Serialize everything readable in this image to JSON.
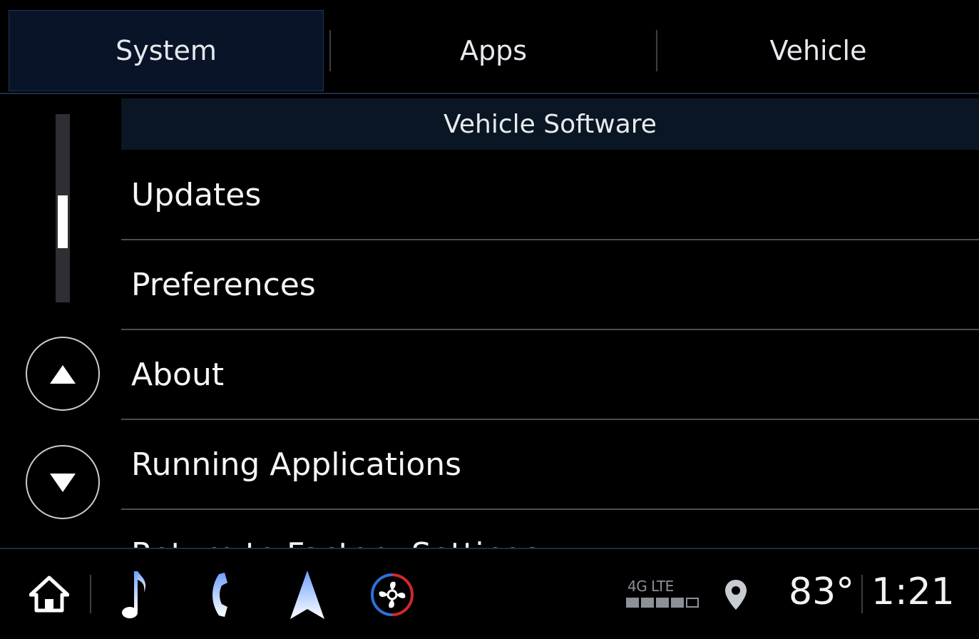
{
  "tabs": [
    {
      "label": "System",
      "active": true
    },
    {
      "label": "Apps",
      "active": false
    },
    {
      "label": "Vehicle",
      "active": false
    }
  ],
  "section": {
    "title": "Vehicle Software"
  },
  "list": {
    "items": [
      {
        "label": "Updates"
      },
      {
        "label": "Preferences"
      },
      {
        "label": "About"
      },
      {
        "label": "Running Applications"
      },
      {
        "label": "Return to Factory Settings"
      }
    ]
  },
  "scroll": {
    "position_fraction": 0.6,
    "thumb_fraction": 0.28
  },
  "status": {
    "network": "4G LTE",
    "signal_bars": 4,
    "signal_max": 5,
    "temperature": "83°",
    "time": "1:21"
  },
  "bottom_icons": [
    "home-icon",
    "music-note-icon",
    "phone-icon",
    "navigation-arrow-icon",
    "climate-fan-icon",
    "location-pin-icon"
  ],
  "colors": {
    "active_tab_bg": "#0a1428",
    "climate_red": "#d0282c",
    "climate_blue": "#2f6fd8",
    "accent_blue": "#3a6fd0"
  }
}
